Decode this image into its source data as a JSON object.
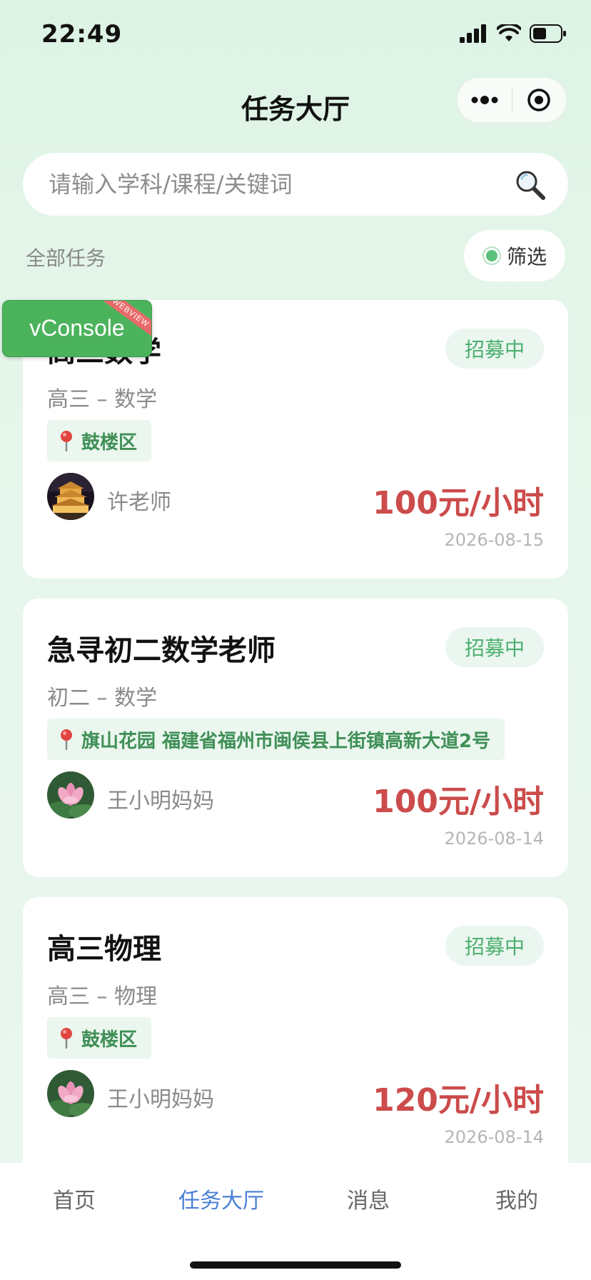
{
  "status_bar": {
    "time": "22:49",
    "icons": [
      "signal-icon",
      "wifi-icon",
      "battery-icon"
    ]
  },
  "nav": {
    "title": "任务大厅",
    "capsule": [
      "more-icon",
      "close-target-icon"
    ]
  },
  "search": {
    "placeholder": "请输入学科/课程/关键词",
    "value": ""
  },
  "filter": {
    "label": "全部任务",
    "button_label": "筛选"
  },
  "vconsole": {
    "label": "vConsole",
    "ribbon": "WEBVIEW"
  },
  "tasks": [
    {
      "title": "高三数学",
      "status": "招募中",
      "subtitle": "高三 – 数学",
      "location": "鼓楼区",
      "author": "许老师",
      "avatar": "pavilion-night-avatar",
      "price": "100元/小时",
      "date": "2026-08-15"
    },
    {
      "title": "急寻初二数学老师",
      "status": "招募中",
      "subtitle": "初二 – 数学",
      "location": "旗山花园 福建省福州市闽侯县上街镇高新大道2号",
      "author": "王小明妈妈",
      "avatar": "lotus-avatar",
      "price": "100元/小时",
      "date": "2026-08-14"
    },
    {
      "title": "高三物理",
      "status": "招募中",
      "subtitle": "高三 – 物理",
      "location": "鼓楼区",
      "author": "王小明妈妈",
      "avatar": "lotus-avatar",
      "price": "120元/小时",
      "date": "2026-08-14"
    }
  ],
  "tab_bar": {
    "items": [
      {
        "label": "首页",
        "active": false
      },
      {
        "label": "任务大厅",
        "active": true
      },
      {
        "label": "消息",
        "active": false
      },
      {
        "label": "我的",
        "active": false
      }
    ]
  },
  "colors": {
    "accent_green": "#4caf6e",
    "price_red": "#cc4b4b",
    "active_tab_blue": "#4a7fd6",
    "background": "#e3f5e9"
  }
}
